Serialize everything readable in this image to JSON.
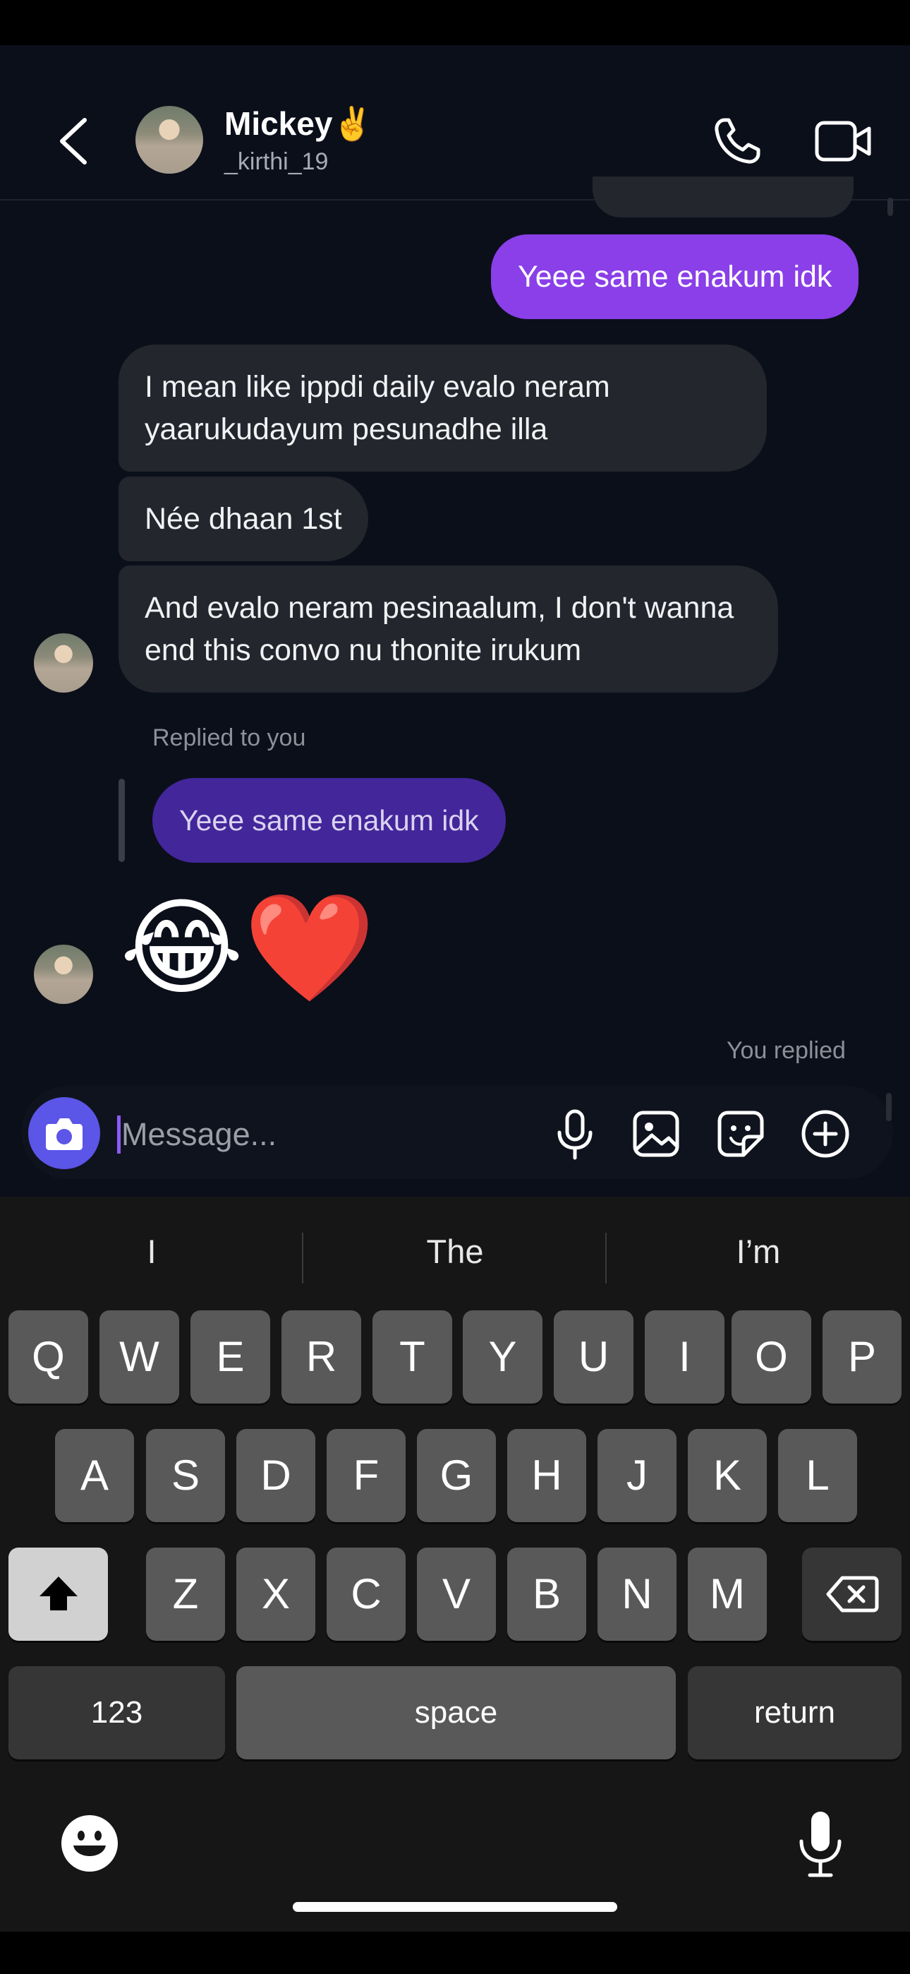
{
  "header": {
    "contact_name": "Mickey✌️",
    "contact_handle": "_kirthi_19"
  },
  "messages": {
    "out_1": "Yeee same enakum idk",
    "in_1": "I mean like ippdi daily evalo neram yaarukudayum pesunadhe illa",
    "in_2": "Née dhaan 1st",
    "in_3": "And evalo neram pesinaalum, I don't wanna end this convo nu thonite irukum",
    "replied_label": "Replied to you",
    "reply_quote": "Yeee same enakum idk",
    "reaction_emojis": "😂❤️",
    "you_replied": "You replied"
  },
  "composer": {
    "placeholder": "Message..."
  },
  "keyboard": {
    "suggestions": [
      "I",
      "The",
      "I’m"
    ],
    "row1": [
      "Q",
      "W",
      "E",
      "R",
      "T",
      "Y",
      "U",
      "I",
      "O",
      "P"
    ],
    "row2": [
      "A",
      "S",
      "D",
      "F",
      "G",
      "H",
      "J",
      "K",
      "L"
    ],
    "row3": [
      "Z",
      "X",
      "C",
      "V",
      "B",
      "N",
      "M"
    ],
    "numbers_label": "123",
    "space_label": "space",
    "return_label": "return"
  },
  "colors": {
    "outgoing_bubble": "#8a3fe8",
    "incoming_bubble": "#24262d",
    "reply_bubble": "#43269a",
    "camera_button": "#5b55e8",
    "background": "#0b0f1a"
  }
}
